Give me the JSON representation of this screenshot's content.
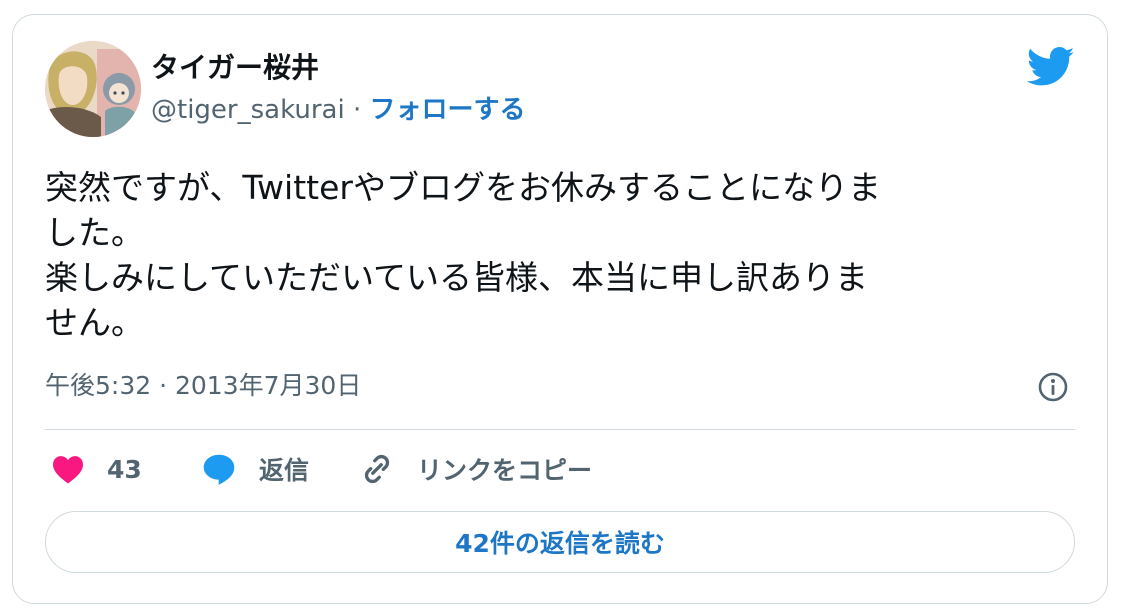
{
  "user": {
    "display_name": "タイガー桜井",
    "handle": "@tiger_sakurai",
    "separator": "·",
    "follow_label": "フォローする"
  },
  "tweet": {
    "lines": [
      "突然ですが、Twitterやブログをお休みすることになりま",
      "した。",
      "楽しみにしていただいている皆様、本当に申し訳ありま",
      "せん。"
    ],
    "timestamp": "午後5:32 · 2013年7月30日"
  },
  "actions": {
    "like_count": "43",
    "reply_label": "返信",
    "copy_link_label": "リンクをコピー"
  },
  "read_replies_label": "42件の返信を読む",
  "icons": {
    "brand": "twitter-bird-icon",
    "info": "info-icon",
    "like": "heart-icon",
    "reply": "speech-bubble-icon",
    "link": "link-icon"
  },
  "colors": {
    "brand": "#1d9bf0",
    "link_text": "#1d77c6",
    "like": "#f91880",
    "muted": "#536471",
    "border": "#cfd9de"
  }
}
